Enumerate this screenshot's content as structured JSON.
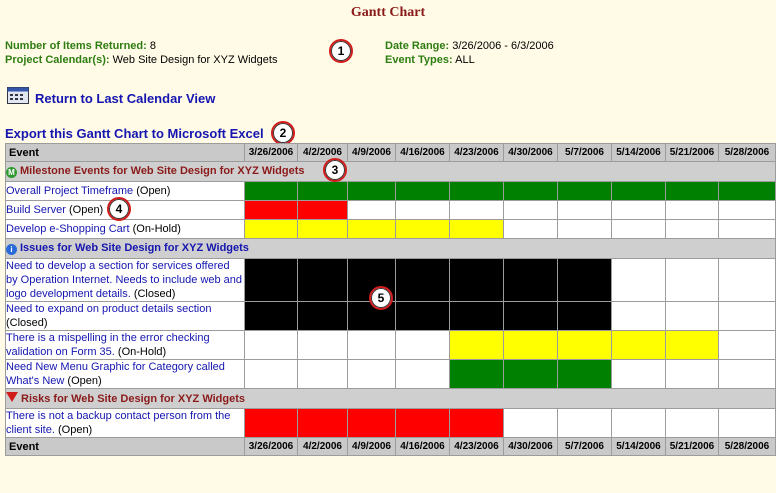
{
  "page_title": "Gantt Chart",
  "summary": {
    "items_label": "Number of Items Returned:",
    "items_value": "8",
    "calendar_label": "Project Calendar(s):",
    "calendar_value": "Web Site Design for XYZ Widgets",
    "date_range_label": "Date Range:",
    "date_range_value": "3/26/2006 - 6/3/2006",
    "event_types_label": "Event Types:",
    "event_types_value": "ALL"
  },
  "links": {
    "return_label": "Return to Last Calendar View",
    "export_label": "Export this Gantt Chart to Microsoft Excel"
  },
  "callouts": [
    "1",
    "2",
    "3",
    "4",
    "5"
  ],
  "table": {
    "event_header": "Event",
    "dates": [
      "3/26/2006",
      "4/2/2006",
      "4/9/2006",
      "4/16/2006",
      "4/23/2006",
      "4/30/2006",
      "5/7/2006",
      "5/14/2006",
      "5/21/2006",
      "5/28/2006"
    ],
    "sections": [
      {
        "title": "Milestone Events for Web Site Design for XYZ Widgets",
        "icon": "milestone-icon",
        "rows": [
          {
            "name": "Overall Project Timeframe",
            "status": "(Open)",
            "cells": "GGGGGGGGGG"
          },
          {
            "name": "Build Server",
            "status": "(Open)",
            "cells": "RRWWWWWWWW"
          },
          {
            "name": "Develop e-Shopping Cart",
            "status": "(On-Hold)",
            "cells": "YYYYYWWWWW"
          }
        ]
      },
      {
        "title": "Issues for Web Site Design for XYZ Widgets",
        "icon": "issue-icon",
        "rows": [
          {
            "name": "Need to develop a section for services offered by Operation Internet. Needs to include web and logo development details.",
            "status": "(Closed)",
            "cells": "KKKKKKKWWW"
          },
          {
            "name": "Need to expand on product details section",
            "status": "(Closed)",
            "cells": "KKKKKKKWWW"
          },
          {
            "name": "There is a mispelling in the error checking validation on Form 35.",
            "status": "(On-Hold)",
            "cells": "WWWWYYYYYW"
          },
          {
            "name": "Need New Menu Graphic for Category called What's New",
            "status": "(Open)",
            "cells": "WWWWGGGWWW"
          }
        ]
      },
      {
        "title": "Risks for Web Site Design for XYZ Widgets",
        "icon": "risk-icon",
        "rows": [
          {
            "name": "There is not a backup contact person from the client site.",
            "status": "(Open)",
            "cells": "RRRRRWWWWW"
          }
        ]
      }
    ]
  },
  "colors": {
    "G": "#008000",
    "R": "#ff0000",
    "Y": "#ffff00",
    "K": "#000000",
    "W": "#ffffff",
    "section_text": "#8b1a1a",
    "link": "#1515b0",
    "label_green": "#2e7d12"
  }
}
